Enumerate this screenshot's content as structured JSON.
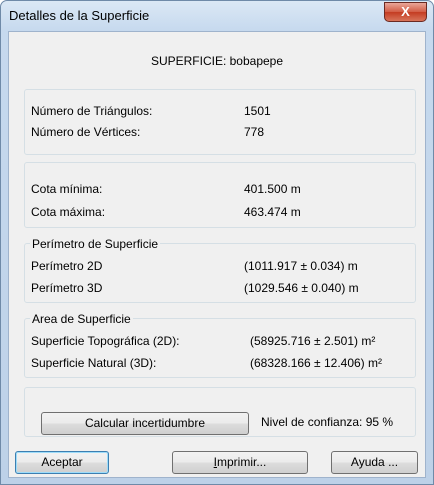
{
  "window": {
    "title": "Detalles de la Superficie",
    "close_glyph": "X"
  },
  "header": {
    "surface_label": "SUPERFICIE: bobapepe"
  },
  "counts": {
    "triangles_label": "Número de Triángulos:",
    "triangles_value": "1501",
    "vertices_label": "Número de Vértices:",
    "vertices_value": "778"
  },
  "elevations": {
    "min_label": "Cota mínima:",
    "min_value": "401.500 m",
    "max_label": "Cota máxima:",
    "max_value": "463.474 m"
  },
  "perimeter": {
    "legend": "Perímetro de Superficie",
    "p2d_label": "Perímetro 2D",
    "p2d_value": "(1011.917 ± 0.034) m",
    "p3d_label": "Perímetro 3D",
    "p3d_value": "(1029.546 ± 0.040) m"
  },
  "area": {
    "legend": "Area de Superficie",
    "topo_label": "Superficie Topográfica (2D):",
    "topo_value": "(58925.716 ± 2.501) m²",
    "natural_label": "Superficie Natural (3D):",
    "natural_value": "(68328.166 ± 12.406) m²"
  },
  "uncertainty": {
    "button_label": "Calcular incertidumbre",
    "confidence_text": "Nivel de confianza: 95 %"
  },
  "buttons": {
    "accept": "Aceptar",
    "print_first": "I",
    "print_rest": "mprimir...",
    "help": "Ayuda ..."
  }
}
